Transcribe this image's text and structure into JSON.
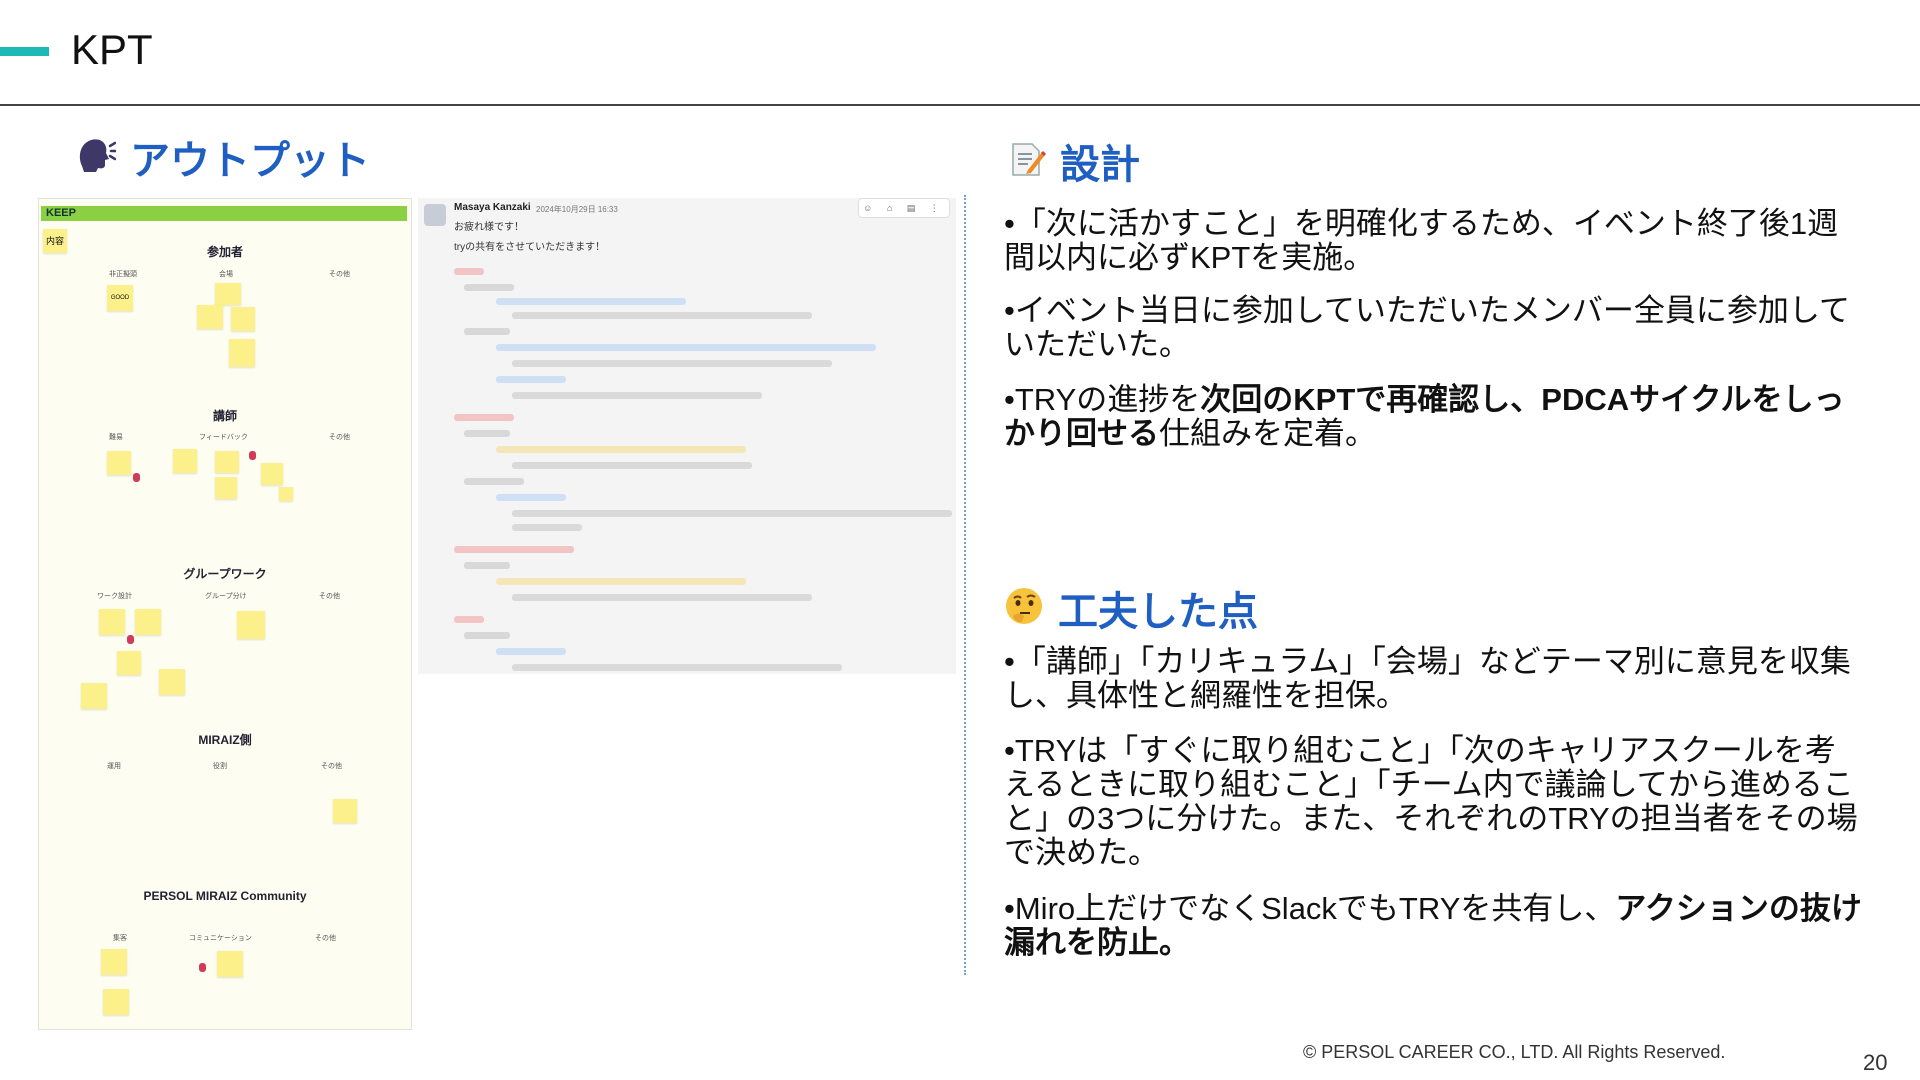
{
  "header": {
    "title": "KPT"
  },
  "output": {
    "heading": "アウトプット",
    "board": {
      "tag": "KEEP",
      "content_label": "内容",
      "sections": [
        {
          "title": "参加者",
          "subs": [
            "非正擬頭",
            "会場",
            "その他"
          ]
        },
        {
          "title": "講師",
          "subs": [
            "難易",
            "フィードバック",
            "その他"
          ]
        },
        {
          "title": "グループワーク",
          "subs": [
            "ワーク設計",
            "グループ分け",
            "その他"
          ]
        },
        {
          "title": "MIRAIZ側",
          "subs": [
            "運用",
            "役割",
            "その他"
          ]
        },
        {
          "title": "PERSOL MIRAIZ Community",
          "subs": [
            "集客",
            "コミュニケーション",
            "その他"
          ]
        }
      ],
      "note_text": "GOOD"
    },
    "slack": {
      "name": "Masaya Kanzaki",
      "time": "2024年10月29日 16:33",
      "line1": "お疲れ様です！",
      "line2": "tryの共有をさせていただきます！",
      "tools": "☺ ⌂ ▤ ⋮"
    }
  },
  "design": {
    "heading": "設計",
    "p1": "•「次に活かすこと」を明確化するため、イベント終了後1週間以内に必ずKPTを実施。",
    "p2": "•イベント当日に参加していただいたメンバー全員に参加していただいた。",
    "p3_pre": "•TRYの進捗を",
    "p3_bold": "次回のKPTで再確認し、PDCAサイクルをしっかり回せる",
    "p3_post": "仕組みを定着。"
  },
  "ideas": {
    "heading": "工夫した点",
    "p1": "•「講師」「カリキュラム」「会場」などテーマ別に意見を収集し、具体性と網羅性を担保。",
    "p2": "•TRYは「すぐに取り組むこと」「次のキャリアスクールを考えるときに取り組むこと」「チーム内で議論してから進めること」の3つに分けた。また、それぞれのTRYの担当者をその場で決めた。",
    "p3_pre": "•Miro上だけでなくSlackでもTRYを共有し、",
    "p3_bold": "アクションの抜け漏れを防止。"
  },
  "footer": {
    "copyright": "© PERSOL CAREER CO., LTD. All Rights Reserved.",
    "page": "20"
  }
}
